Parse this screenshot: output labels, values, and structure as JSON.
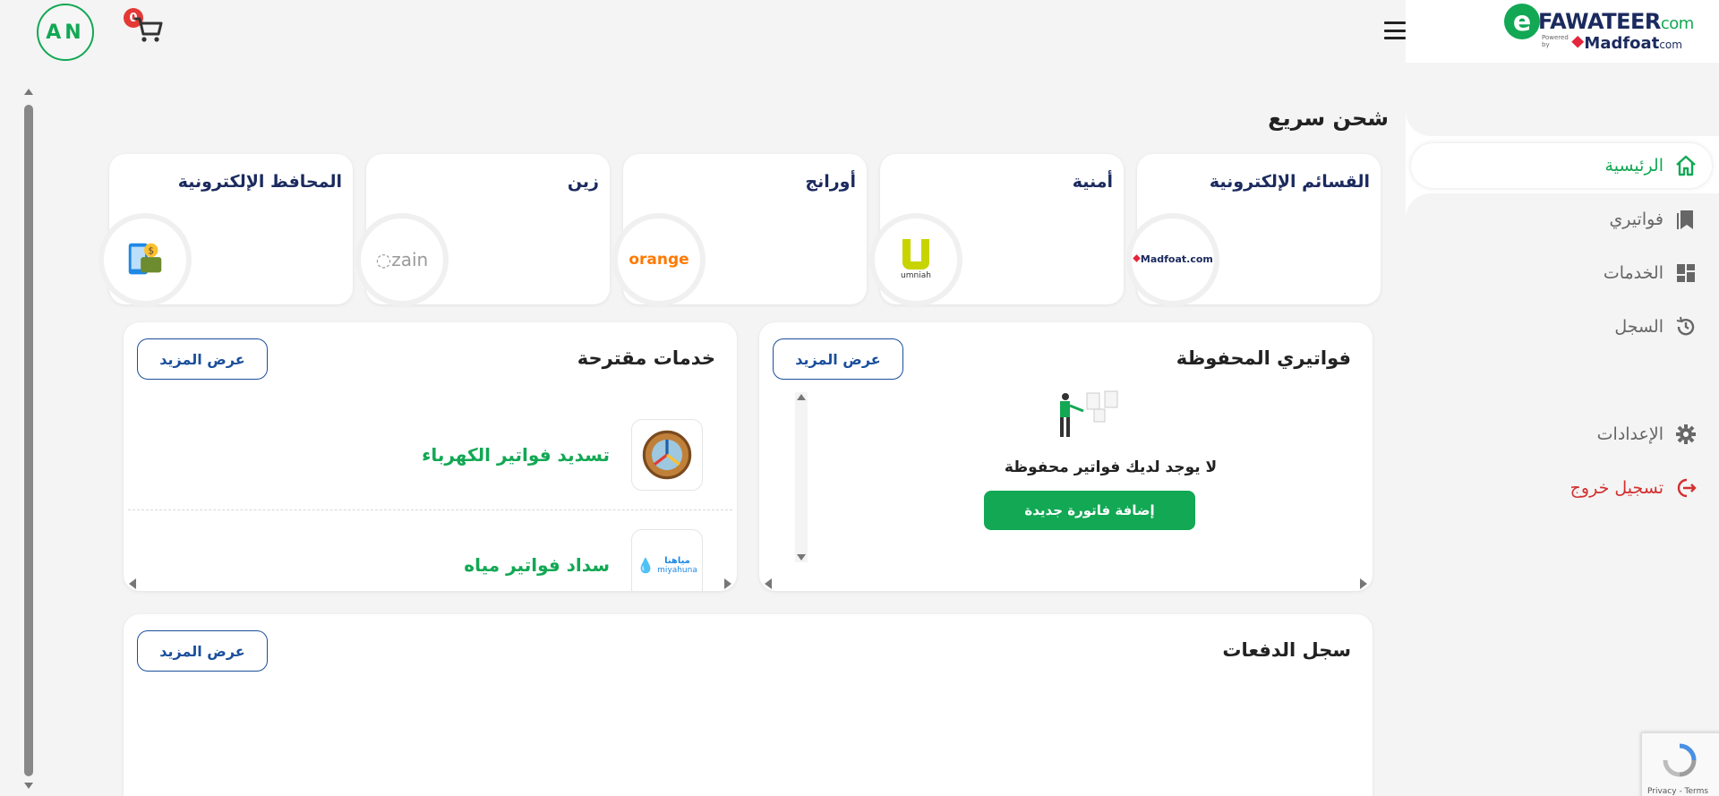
{
  "header": {
    "avatar_initials": "AN",
    "cart_count": "0"
  },
  "brand": {
    "logo_e": "e",
    "name": "FAWATEER",
    "domain": "com",
    "powered_by": "Powered by",
    "partner": "Madfoat",
    "partner_domain": "com",
    "primary_color": "#12a854",
    "navy_color": "#1b2a5e"
  },
  "sidebar": {
    "items": [
      {
        "label": "الرئيسية",
        "icon": "home-icon"
      },
      {
        "label": "فواتيري",
        "icon": "bookmark-icon"
      },
      {
        "label": "الخدمات",
        "icon": "grid-icon"
      },
      {
        "label": "السجل",
        "icon": "history-icon"
      },
      {
        "label": "الإعدادات",
        "icon": "gear-icon"
      },
      {
        "label": "تسجيل خروج",
        "icon": "logout-icon"
      }
    ]
  },
  "quick_topup": {
    "title": "شحن سريع",
    "cards": [
      {
        "name": "القسائم الإلكترونية",
        "logo": "Madfoat.com"
      },
      {
        "name": "أمنية",
        "logo": "umniah"
      },
      {
        "name": "أورانج",
        "logo": "orange"
      },
      {
        "name": "زين",
        "logo": "zain"
      },
      {
        "name": "المحافظ الإلكترونية",
        "logo": "wallet-icon"
      }
    ]
  },
  "saved_bills": {
    "title": "فواتيري المحفوظة",
    "more_label": "عرض المزيد",
    "empty_message": "لا يوجد لديك فواتير محفوظة",
    "add_button": "إضافة فاتورة جديدة"
  },
  "suggested_services": {
    "title": "خدمات مقترحة",
    "more_label": "عرض المزيد",
    "items": [
      {
        "label": "تسديد فواتير الكهرباء",
        "icon": "electricity-icon"
      },
      {
        "label": "سداد فواتير مياه",
        "icon": "water-icon",
        "brand_ar": "مياهنا",
        "brand_en": "miyahuna"
      }
    ]
  },
  "payments_log": {
    "title": "سجل الدفعات",
    "more_label": "عرض المزيد"
  },
  "recaptcha": {
    "text": "Privacy - Terms"
  }
}
